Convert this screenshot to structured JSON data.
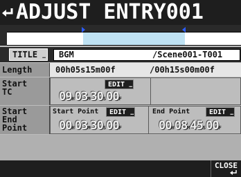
{
  "header": {
    "title": "ADJUST ENTRY001"
  },
  "timeline": {
    "region_color": "#bfe2f3"
  },
  "title_row": {
    "button_label": "TITLE",
    "name_value": "BGM",
    "sub_value": "/Scene001-T001"
  },
  "length_row": {
    "label": "Length",
    "value": "00h05s15m00f",
    "total": "/00h15s00m00f"
  },
  "start_tc": {
    "label_line1": "Start",
    "label_line2": "TC",
    "edit_label": "EDIT",
    "tc": {
      "h": "09",
      "m": "03",
      "s": "30",
      "f": "00"
    }
  },
  "start_end": {
    "label_line1": "Start",
    "label_line2": "End",
    "label_line3": "Point",
    "start_point_label": "Start Point",
    "end_point_label": "End Point",
    "edit_label": "EDIT",
    "start_tc": {
      "h": "00",
      "m": "03",
      "s": "30",
      "f": "00"
    },
    "end_tc": {
      "h": "00",
      "m": "08",
      "s": "45",
      "f": "00"
    }
  },
  "footer": {
    "close_label": "CLOSE"
  },
  "units": {
    "h": "H",
    "m": "M",
    "s": "S",
    "f": "F"
  },
  "icons": {
    "back": "return-arrow-icon",
    "close": "return-arrow-icon"
  }
}
